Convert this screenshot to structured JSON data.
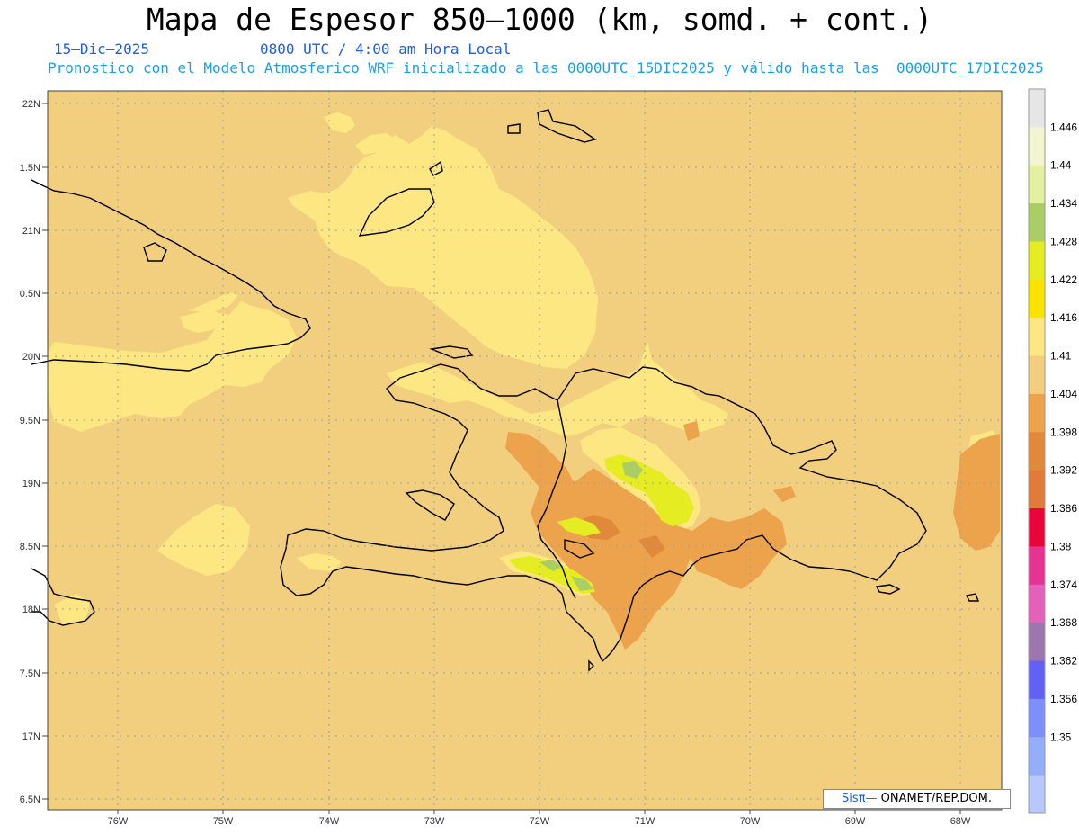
{
  "header": {
    "title": "Mapa de Espesor 850—1000 (km, somd. + cont.)",
    "date": "15—Dic—2025",
    "time": "0800 UTC / 4:00 am Hora Local",
    "forecast": "Pronostico con el Modelo Atmosferico WRF inicializado a las 0000UTC_15DIC2025 y válido hasta las  0000UTC_17DIC2025"
  },
  "map": {
    "lat_labels": [
      "22N",
      "1.5N",
      "21N",
      "0.5N",
      "20N",
      "9.5N",
      "19N",
      "8.5N",
      "18N",
      "7.5N",
      "17N",
      "6.5N"
    ],
    "lon_labels": [
      "76W",
      "75W",
      "74W",
      "73W",
      "72W",
      "71W",
      "70W",
      "69W",
      "68W"
    ],
    "background_color": "#f2cf7e",
    "contour_colors": {
      "light_yellow": "#fde783",
      "orange": "#eda34c",
      "dark_orange": "#e1893b",
      "yellow": "#e5ec21",
      "green": "#aacd65"
    }
  },
  "colorbar": {
    "labels": [
      "1.446",
      "1.44",
      "1.434",
      "1.428",
      "1.422",
      "1.416",
      "1.41",
      "1.404",
      "1.398",
      "1.392",
      "1.386",
      "1.38",
      "1.374",
      "1.368",
      "1.362",
      "1.356",
      "1.35"
    ],
    "colors": [
      "#e6e6e6",
      "#f2f5cf",
      "#e2f0a0",
      "#aacd65",
      "#e5ec21",
      "#fbe301",
      "#fde783",
      "#f2cf7e",
      "#eda34c",
      "#e1893b",
      "#e07b39",
      "#e8053a",
      "#e63392",
      "#e361b8",
      "#9d76ad",
      "#6162f5",
      "#7e8efa",
      "#94aefc",
      "#b6c8fc"
    ]
  },
  "credit": {
    "sis": "Sisπ—",
    "org": " ONAMET/REP.DOM."
  }
}
